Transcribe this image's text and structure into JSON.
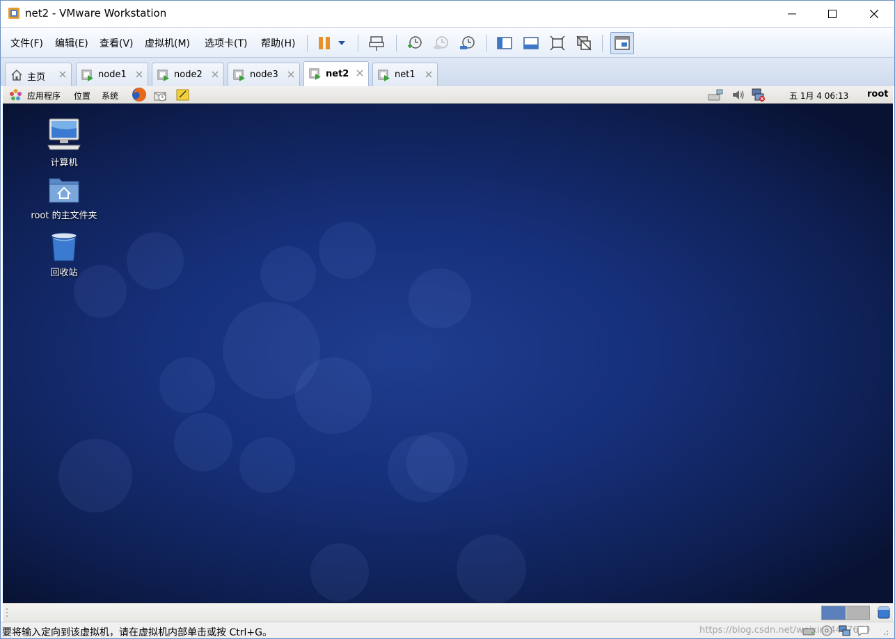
{
  "window": {
    "title": "net2 - VMware Workstation",
    "icon": "vmware-app-icon"
  },
  "menu": {
    "file": "文件(F)",
    "edit": "编辑(E)",
    "view": "查看(V)",
    "vm": "虚拟机(M)",
    "tabs": "选项卡(T)",
    "help": "帮助(H)"
  },
  "toolbar": {
    "icons": [
      "pause-icon",
      "dropdown-arrow-icon",
      "send-ctrl-alt-del-icon",
      "snapshot-take-icon",
      "snapshot-revert-icon",
      "snapshot-manager-icon",
      "sidebar-icon",
      "thumbnail-bar-icon",
      "fullscreen-icon",
      "unity-icon",
      "console-view-icon"
    ]
  },
  "tabs": [
    {
      "label": "主页",
      "icon": "home-icon",
      "active": false
    },
    {
      "label": "node1",
      "icon": "vm-running-icon",
      "active": false
    },
    {
      "label": "node2",
      "icon": "vm-running-icon",
      "active": false
    },
    {
      "label": "node3",
      "icon": "vm-running-icon",
      "active": false
    },
    {
      "label": "net2",
      "icon": "vm-running-icon",
      "active": true
    },
    {
      "label": "net1",
      "icon": "vm-running-icon",
      "active": false
    }
  ],
  "guest_panel": {
    "applications": "应用程序",
    "places": "位置",
    "system": "系统",
    "clock": "五  1月   4 06:13",
    "user": "root"
  },
  "desktop_icons": [
    {
      "label": "计算机",
      "icon": "computer-icon"
    },
    {
      "label": "root 的主文件夹",
      "icon": "home-folder-icon"
    },
    {
      "label": "回收站",
      "icon": "trash-icon"
    }
  ],
  "statusbar": {
    "message": "要将输入定向到该虚拟机，请在虚拟机内部单击或按 Ctrl+G。",
    "watermark": "https://blog.csdn.net/weixin_4467670"
  },
  "colors": {
    "desktop_bg": "#16307a",
    "tab_bar": "#cfdbee",
    "workspace_active": "#5b7fba"
  }
}
